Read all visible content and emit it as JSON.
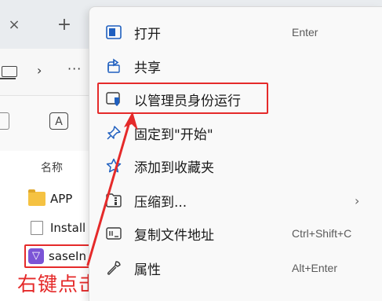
{
  "explorer": {
    "tab_close_icon": "×",
    "tab_new_icon": "+",
    "breadcrumb_chevron": "›",
    "more": "···",
    "rename_icon_glyph": "A",
    "column_name": "名称",
    "files": [
      {
        "name": "APP",
        "icon": "folder-icon"
      },
      {
        "name": "Install",
        "icon": "document-icon"
      },
      {
        "name": "saseIn",
        "icon": "sase-app-icon"
      }
    ]
  },
  "annotation": {
    "text": "右键点击",
    "color": "#e52a2a"
  },
  "context_menu": {
    "items": [
      {
        "label": "打开",
        "shortcut": "Enter",
        "icon": "open-icon"
      },
      {
        "label": "共享",
        "shortcut": "",
        "icon": "share-icon"
      },
      {
        "label": "以管理员身份运行",
        "shortcut": "",
        "icon": "shield-run-as-admin-icon"
      },
      {
        "label": "固定到\"开始\"",
        "shortcut": "",
        "icon": "pin-icon"
      },
      {
        "label": "添加到收藏夹",
        "shortcut": "",
        "icon": "star-icon"
      },
      {
        "label": "压缩到...",
        "shortcut": "",
        "icon": "zip-icon",
        "submenu_arrow": "›"
      },
      {
        "label": "复制文件地址",
        "shortcut": "Ctrl+Shift+C",
        "icon": "copy-path-icon"
      },
      {
        "label": "属性",
        "shortcut": "Alt+Enter",
        "icon": "wrench-icon"
      }
    ]
  }
}
